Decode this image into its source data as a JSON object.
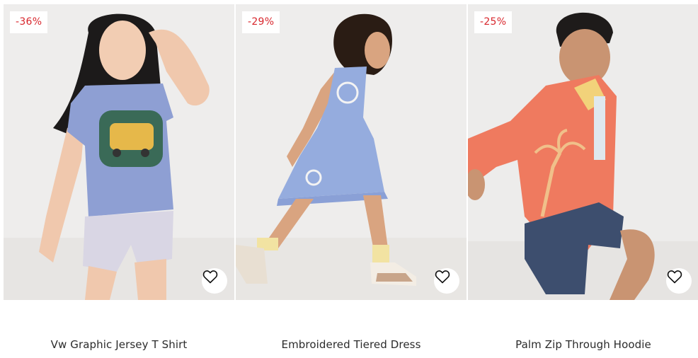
{
  "products": [
    {
      "discount": "-36%",
      "name": "Vw Graphic Jersey T Shirt",
      "wishlist_icon": "heart-outline-icon"
    },
    {
      "discount": "-29%",
      "name": "Embroidered Tiered Dress",
      "wishlist_icon": "heart-outline-icon"
    },
    {
      "discount": "-25%",
      "name": "Palm Zip Through Hoodie",
      "wishlist_icon": "heart-outline-icon"
    }
  ],
  "colors": {
    "discount_text": "#d8262c",
    "photo_background": "#ecebea",
    "title_text": "#2b2b2b"
  }
}
